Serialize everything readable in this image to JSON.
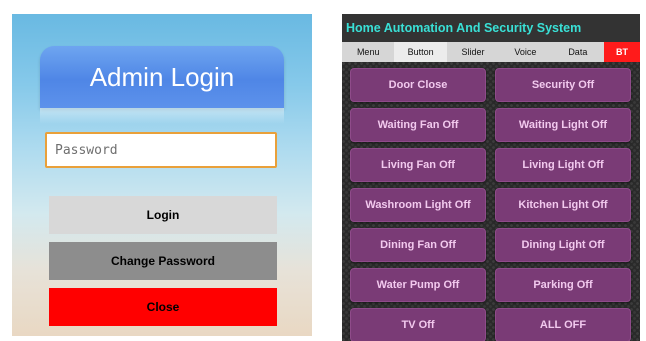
{
  "login": {
    "title": "Admin Login",
    "password_placeholder": "Password",
    "login_label": "Login",
    "change_password_label": "Change Password",
    "close_label": "Close"
  },
  "home": {
    "title": "Home Automation And Security System",
    "tabs": [
      {
        "label": "Menu"
      },
      {
        "label": "Button"
      },
      {
        "label": "Slider"
      },
      {
        "label": "Voice"
      },
      {
        "label": "Data"
      },
      {
        "label": "BT"
      }
    ],
    "active_tab": "Button",
    "buttons": [
      {
        "label": "Door Close"
      },
      {
        "label": "Security Off"
      },
      {
        "label": "Waiting Fan Off"
      },
      {
        "label": "Waiting Light Off"
      },
      {
        "label": "Living Fan Off"
      },
      {
        "label": "Living Light Off"
      },
      {
        "label": "Washroom Light Off"
      },
      {
        "label": "Kitchen Light Off"
      },
      {
        "label": "Dining Fan Off"
      },
      {
        "label": "Dining Light Off"
      },
      {
        "label": "Water Pump Off"
      },
      {
        "label": "Parking Off"
      },
      {
        "label": "TV Off"
      },
      {
        "label": "ALL OFF"
      }
    ]
  },
  "colors": {
    "header_blue": "#4f86e6",
    "input_border": "#e9a03a",
    "close_red": "#ff0000",
    "title_teal": "#39e0d6",
    "button_purple": "#7a3b76",
    "bt_tab_red": "#ff1b1b"
  }
}
